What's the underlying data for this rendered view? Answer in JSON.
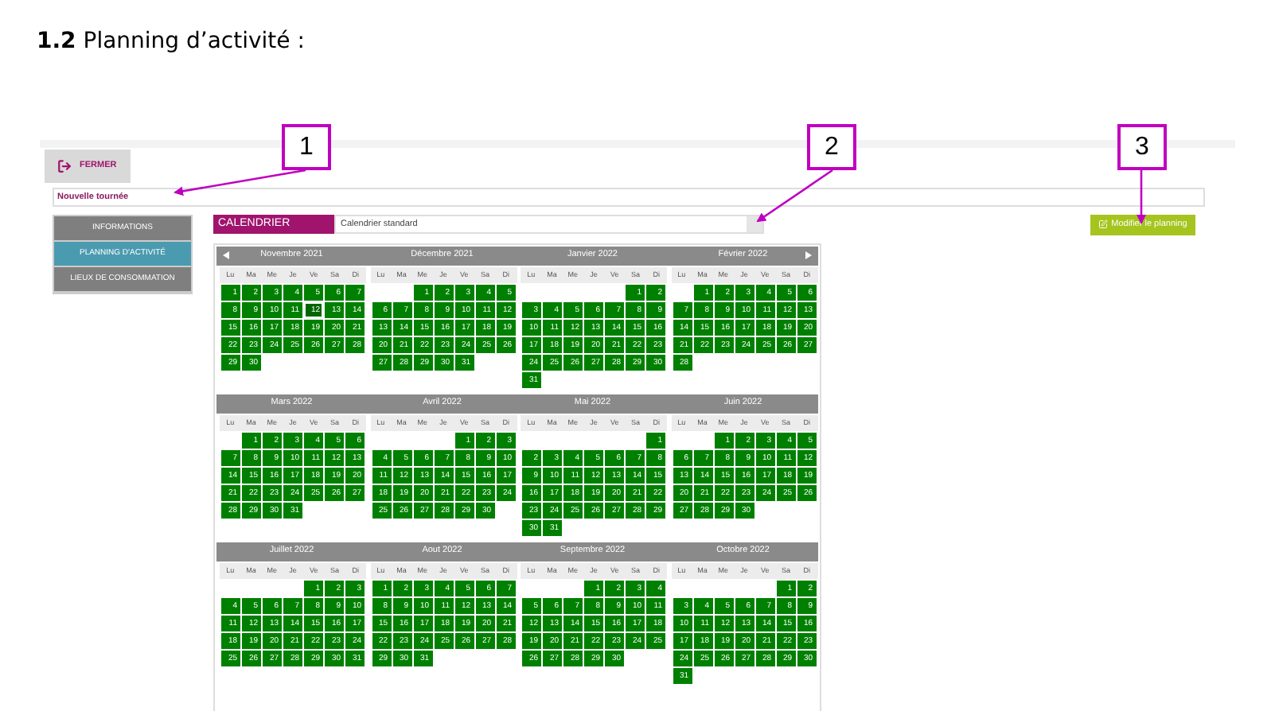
{
  "heading": "**1.2** Planning d’activité :",
  "callouts": [
    "1",
    "2",
    "3"
  ],
  "app": {
    "close_button": "FERMER",
    "name_field": "Nouvelle tournée",
    "sidebar": [
      {
        "label": "INFORMATIONS",
        "selected": false
      },
      {
        "label": "PLANNING D'ACTIVITÉ",
        "selected": true
      },
      {
        "label": "LIEUX DE CONSOMMATION",
        "selected": false
      }
    ],
    "calendar_label": "CALENDRIER",
    "calendar_select": "Calendrier standard",
    "edit_button": "Modifier le planning",
    "months": [
      {
        "title": "Novembre 2021",
        "weekdays": [
          "Lu",
          "Ma",
          "Me",
          "Je",
          "Ve",
          "Sa",
          "Di"
        ],
        "weeks": [
          [
            "1",
            "2",
            "3",
            "4",
            "5",
            "6",
            "7"
          ],
          [
            "8",
            "9",
            "10",
            "11",
            {
              "d": "12",
              "today": true
            },
            "13",
            "14"
          ],
          [
            "15",
            "16",
            "17",
            "18",
            "19",
            "20",
            "21"
          ],
          [
            "22",
            "23",
            "24",
            "25",
            "26",
            "27",
            "28"
          ],
          [
            "29",
            "30"
          ]
        ]
      },
      {
        "title": "Décembre 2021",
        "weekdays": [
          "Lu",
          "Ma",
          "Me",
          "Je",
          "Ve",
          "Sa",
          "Di"
        ],
        "weeks": [
          [
            "1",
            "2",
            "3",
            "4",
            "5"
          ],
          [
            "6",
            "7",
            "8",
            "9",
            "10",
            "11",
            "12"
          ],
          [
            "13",
            "14",
            "15",
            "16",
            "17",
            "18",
            "19"
          ],
          [
            "20",
            "21",
            "22",
            "23",
            "24",
            "25",
            "26"
          ],
          [
            "27",
            "28",
            "29",
            "30",
            "31"
          ]
        ]
      },
      {
        "title": "Janvier 2022",
        "weekdays": [
          "Lu",
          "Ma",
          "Me",
          "Je",
          "Ve",
          "Sa",
          "Di"
        ],
        "weeks": [
          [
            "1",
            "2"
          ],
          [
            "3",
            "4",
            "5",
            "6",
            "7",
            "8",
            "9"
          ],
          [
            "10",
            "11",
            "12",
            "13",
            "14",
            "15",
            "16"
          ],
          [
            "17",
            "18",
            "19",
            "20",
            "21",
            "22",
            "23"
          ],
          [
            "24",
            "25",
            "26",
            "27",
            "28",
            "29",
            "30"
          ],
          [
            "31"
          ]
        ]
      },
      {
        "title": "Février 2022",
        "weekdays": [
          "Lu",
          "Ma",
          "Me",
          "Je",
          "Ve",
          "Sa",
          "Di"
        ],
        "weeks": [
          [
            "1",
            "2",
            "3",
            "4",
            "5",
            "6"
          ],
          [
            "7",
            "8",
            "9",
            "10",
            "11",
            "12",
            "13"
          ],
          [
            "14",
            "15",
            "16",
            "17",
            "18",
            "19",
            "20"
          ],
          [
            "21",
            "22",
            "23",
            "24",
            "25",
            "26",
            "27"
          ],
          [
            "28"
          ]
        ]
      },
      {
        "title": "Mars 2022",
        "weekdays": [
          "Lu",
          "Ma",
          "Me",
          "Je",
          "Ve",
          "Sa",
          "Di"
        ],
        "weeks": [
          [
            "1",
            "2",
            "3",
            "4",
            "5",
            "6"
          ],
          [
            "7",
            "8",
            "9",
            "10",
            "11",
            "12",
            "13"
          ],
          [
            "14",
            "15",
            "16",
            "17",
            "18",
            "19",
            "20"
          ],
          [
            "21",
            "22",
            "23",
            "24",
            "25",
            "26",
            "27"
          ],
          [
            "28",
            "29",
            "30",
            "31"
          ]
        ]
      },
      {
        "title": "Avril 2022",
        "weekdays": [
          "Lu",
          "Ma",
          "Me",
          "Je",
          "Ve",
          "Sa",
          "Di"
        ],
        "weeks": [
          [
            "1",
            "2",
            "3"
          ],
          [
            "4",
            "5",
            "6",
            "7",
            "8",
            "9",
            "10"
          ],
          [
            "11",
            "12",
            "13",
            "14",
            "15",
            "16",
            "17"
          ],
          [
            "18",
            "19",
            "20",
            "21",
            "22",
            "23",
            "24"
          ],
          [
            "25",
            "26",
            "27",
            "28",
            "29",
            "30"
          ]
        ]
      },
      {
        "title": "Mai 2022",
        "weekdays": [
          "Lu",
          "Ma",
          "Me",
          "Je",
          "Ve",
          "Sa",
          "Di"
        ],
        "weeks": [
          [
            "1"
          ],
          [
            "2",
            "3",
            "4",
            "5",
            "6",
            "7",
            "8"
          ],
          [
            "9",
            "10",
            "11",
            "12",
            "13",
            "14",
            "15"
          ],
          [
            "16",
            "17",
            "18",
            "19",
            "20",
            "21",
            "22"
          ],
          [
            "23",
            "24",
            "25",
            "26",
            "27",
            "28",
            "29"
          ],
          [
            "30",
            "31"
          ]
        ]
      },
      {
        "title": "Juin 2022",
        "weekdays": [
          "Lu",
          "Ma",
          "Me",
          "Je",
          "Ve",
          "Sa",
          "Di"
        ],
        "weeks": [
          [
            "1",
            "2",
            "3",
            "4",
            "5"
          ],
          [
            "6",
            "7",
            "8",
            "9",
            "10",
            "11",
            "12"
          ],
          [
            "13",
            "14",
            "15",
            "16",
            "17",
            "18",
            "19"
          ],
          [
            "20",
            "21",
            "22",
            "23",
            "24",
            "25",
            "26"
          ],
          [
            "27",
            "28",
            "29",
            "30"
          ]
        ]
      },
      {
        "title": "Juillet 2022",
        "weekdays": [
          "Lu",
          "Ma",
          "Me",
          "Je",
          "Ve",
          "Sa",
          "Di"
        ],
        "weeks": [
          [
            "1",
            "2",
            "3"
          ],
          [
            "4",
            "5",
            "6",
            "7",
            "8",
            "9",
            "10"
          ],
          [
            "11",
            "12",
            "13",
            "14",
            "15",
            "16",
            "17"
          ],
          [
            "18",
            "19",
            "20",
            "21",
            "22",
            "23",
            "24"
          ],
          [
            "25",
            "26",
            "27",
            "28",
            "29",
            "30",
            "31"
          ]
        ]
      },
      {
        "title": "Aout 2022",
        "weekdays": [
          "Lu",
          "Ma",
          "Me",
          "Je",
          "Ve",
          "Sa",
          "Di"
        ],
        "weeks": [
          [
            "1",
            "2",
            "3",
            "4",
            "5",
            "6",
            "7"
          ],
          [
            "8",
            "9",
            "10",
            "11",
            "12",
            "13",
            "14"
          ],
          [
            "15",
            "16",
            "17",
            "18",
            "19",
            "20",
            "21"
          ],
          [
            "22",
            "23",
            "24",
            "25",
            "26",
            "27",
            "28"
          ],
          [
            "29",
            "30",
            "31"
          ]
        ]
      },
      {
        "title": "Septembre 2022",
        "weekdays": [
          "Lu",
          "Ma",
          "Me",
          "Je",
          "Ve",
          "Sa",
          "Di"
        ],
        "weeks": [
          [
            "1",
            "2",
            "3",
            "4"
          ],
          [
            "5",
            "6",
            "7",
            "8",
            "9",
            "10",
            "11"
          ],
          [
            "12",
            "13",
            "14",
            "15",
            "16",
            "17",
            "18"
          ],
          [
            "19",
            "20",
            "21",
            "22",
            "23",
            "24",
            "25"
          ],
          [
            "26",
            "27",
            "28",
            "29",
            "30"
          ]
        ]
      },
      {
        "title": "Octobre 2022",
        "weekdays": [
          "Lu",
          "Ma",
          "Me",
          "Je",
          "Ve",
          "Sa",
          "Di"
        ],
        "weeks": [
          [
            "1",
            "2"
          ],
          [
            "3",
            "4",
            "5",
            "6",
            "7",
            "8",
            "9"
          ],
          [
            "10",
            "11",
            "12",
            "13",
            "14",
            "15",
            "16"
          ],
          [
            "17",
            "18",
            "19",
            "20",
            "21",
            "22",
            "23"
          ],
          [
            "24",
            "25",
            "26",
            "27",
            "28",
            "29",
            "30"
          ],
          [
            "31"
          ]
        ]
      }
    ]
  }
}
